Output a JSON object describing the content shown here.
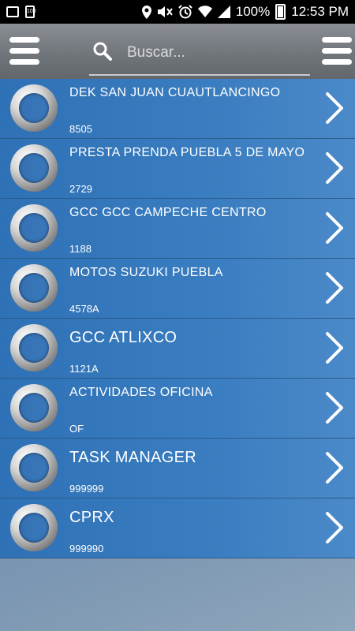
{
  "status_bar": {
    "battery_percent": "100%",
    "time": "12:53 PM",
    "battery_mini_label": "100",
    "left_icons": [
      "image-icon",
      "battery-saver-icon"
    ],
    "right_icons": [
      "location-icon",
      "mute-icon",
      "alarm-icon",
      "wifi-icon",
      "signal-icon",
      "battery-icon"
    ]
  },
  "header": {
    "search_placeholder": "Buscar...",
    "left_menu_icon": "hamburger-menu-icon",
    "right_menu_icon": "hamburger-menu-icon"
  },
  "colors": {
    "header_bg": "#6f7479",
    "row_bg": "#3a7dc0",
    "row_divider": "#2a5b88",
    "text": "#ffffff"
  },
  "items": [
    {
      "title": "DEK SAN JUAN CUAUTLANCINGO",
      "code": "8505",
      "big": false
    },
    {
      "title": "PRESTA PRENDA PUEBLA 5 DE MAYO",
      "code": "2729",
      "big": false
    },
    {
      "title": "GCC GCC CAMPECHE CENTRO",
      "code": "1188",
      "big": false
    },
    {
      "title": "MOTOS SUZUKI PUEBLA",
      "code": "4578A",
      "big": false
    },
    {
      "title": "GCC ATLIXCO",
      "code": "1121A",
      "big": true
    },
    {
      "title": "ACTIVIDADES OFICINA",
      "code": "OF",
      "big": false
    },
    {
      "title": "TASK MANAGER",
      "code": "999999",
      "big": true
    },
    {
      "title": "CPRX",
      "code": "999990",
      "big": true
    }
  ]
}
